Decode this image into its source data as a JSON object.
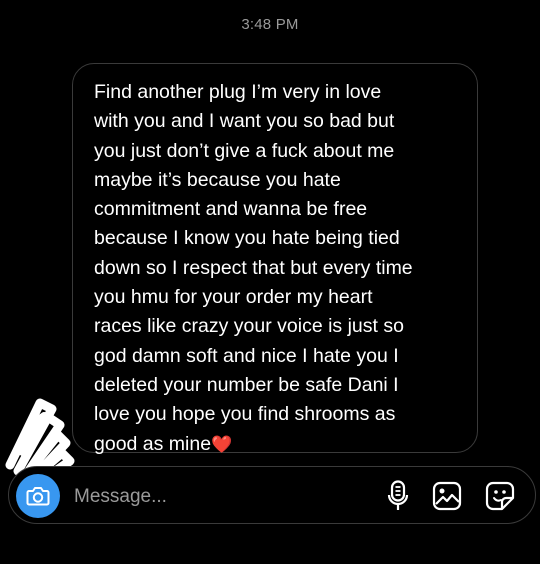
{
  "header": {
    "timestamp": "3:48 PM"
  },
  "message": {
    "text": "Find another plug I’m very in love\nwith you and I want you so bad but\nyou just don’t give a fuck about me\nmaybe it’s because you hate\ncommitment and wanna be free\nbecause I know you hate being tied\ndown so I respect that but every time\nyou hmu for your order my heart\nraces like crazy your voice is just so\ngod damn soft and nice I hate you I\ndeleted your number be safe Dani I\nlove you hope you find shrooms as\ngood as mine",
    "emoji": "❤️"
  },
  "composer": {
    "placeholder": "Message...",
    "value": ""
  },
  "icons": {
    "camera": "camera-icon",
    "mic": "microphone-icon",
    "gallery": "gallery-icon",
    "sticker": "sticker-icon"
  },
  "colors": {
    "background": "#000000",
    "bubble_border": "#3a3a3a",
    "timestamp": "#9a9a9a",
    "camera_accent": "#3897f0",
    "heart": "#e0283b"
  }
}
